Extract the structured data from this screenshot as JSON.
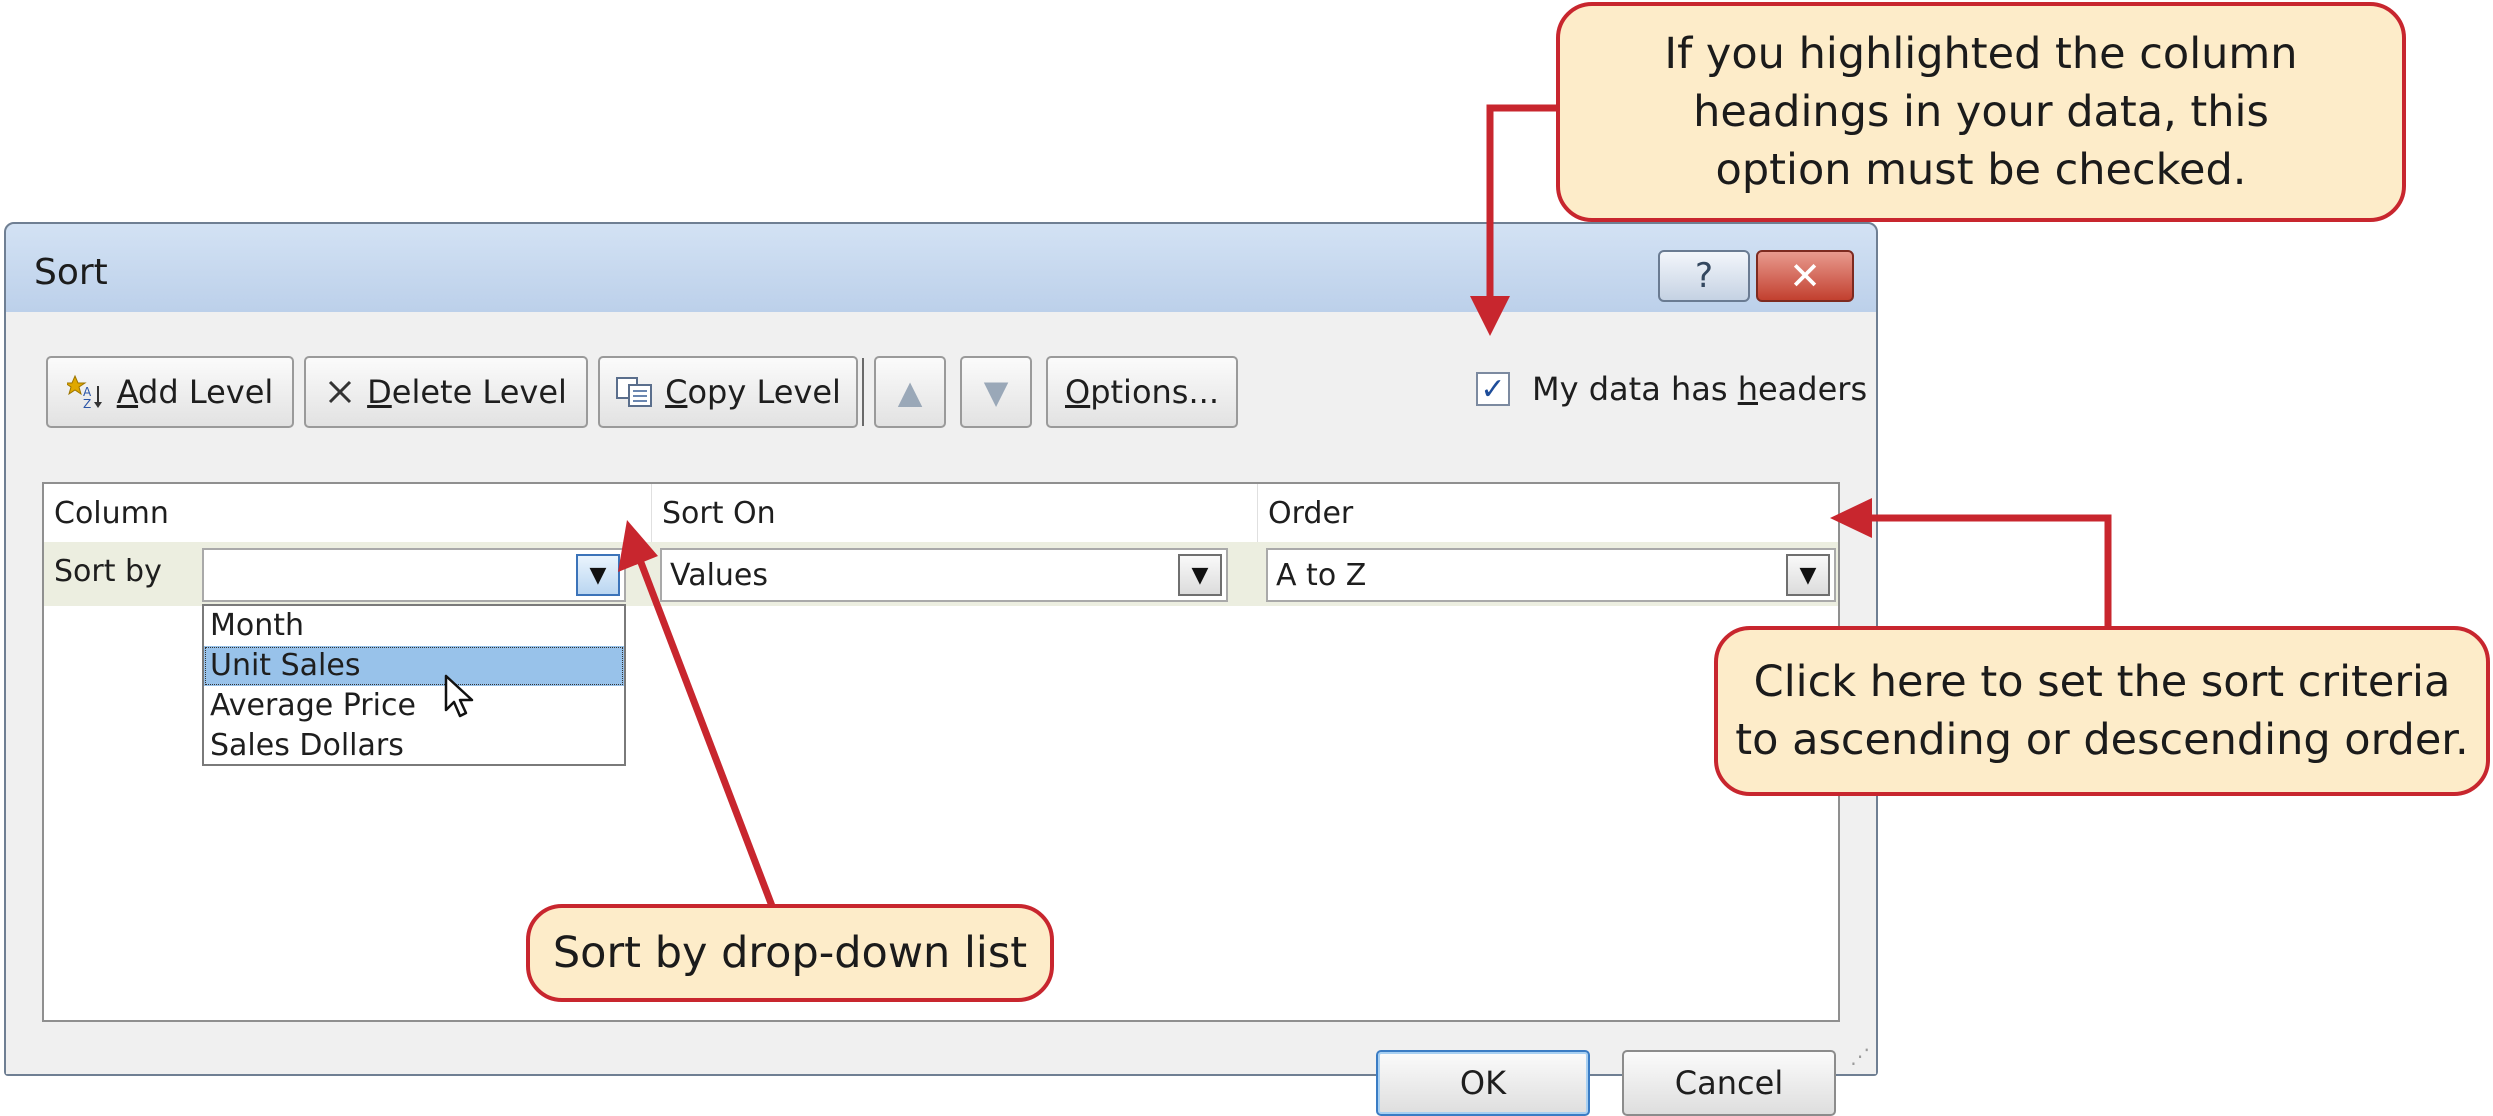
{
  "dialog": {
    "title": "Sort",
    "help_glyph": "?",
    "close_glyph": "✕"
  },
  "toolbar": {
    "add_level": {
      "key": "A",
      "rest": "dd Level"
    },
    "delete_level": {
      "key": "D",
      "rest": "elete Level"
    },
    "copy_level": {
      "key": "C",
      "rest": "opy Level"
    },
    "move_up_glyph": "▲",
    "move_down_glyph": "▼",
    "options": {
      "key": "O",
      "rest": "ptions..."
    },
    "headers_checkbox": {
      "checked": true,
      "label_pre": "My data has ",
      "key": "h",
      "label_post": "eaders"
    }
  },
  "grid": {
    "headers": [
      "Column",
      "Sort On",
      "Order"
    ],
    "row_label": "Sort by",
    "column_value": "",
    "sort_on_value": "Values",
    "order_value": "A to Z",
    "dropdown_options": [
      "Month",
      "Unit Sales",
      "Average Price",
      "Sales Dollars"
    ],
    "selected_option": "Unit Sales"
  },
  "buttons": {
    "ok": "OK",
    "cancel": "Cancel"
  },
  "callouts": {
    "headers": "If you highlighted the column\nheadings in your data, this\noption must be checked.",
    "order": "Click here to set the sort criteria\nto ascending or descending order.",
    "sortby": "Sort by drop-down list"
  },
  "colors": {
    "callout_fill": "#fdecc9",
    "callout_border": "#c8262e",
    "selection": "#98c2ea"
  }
}
